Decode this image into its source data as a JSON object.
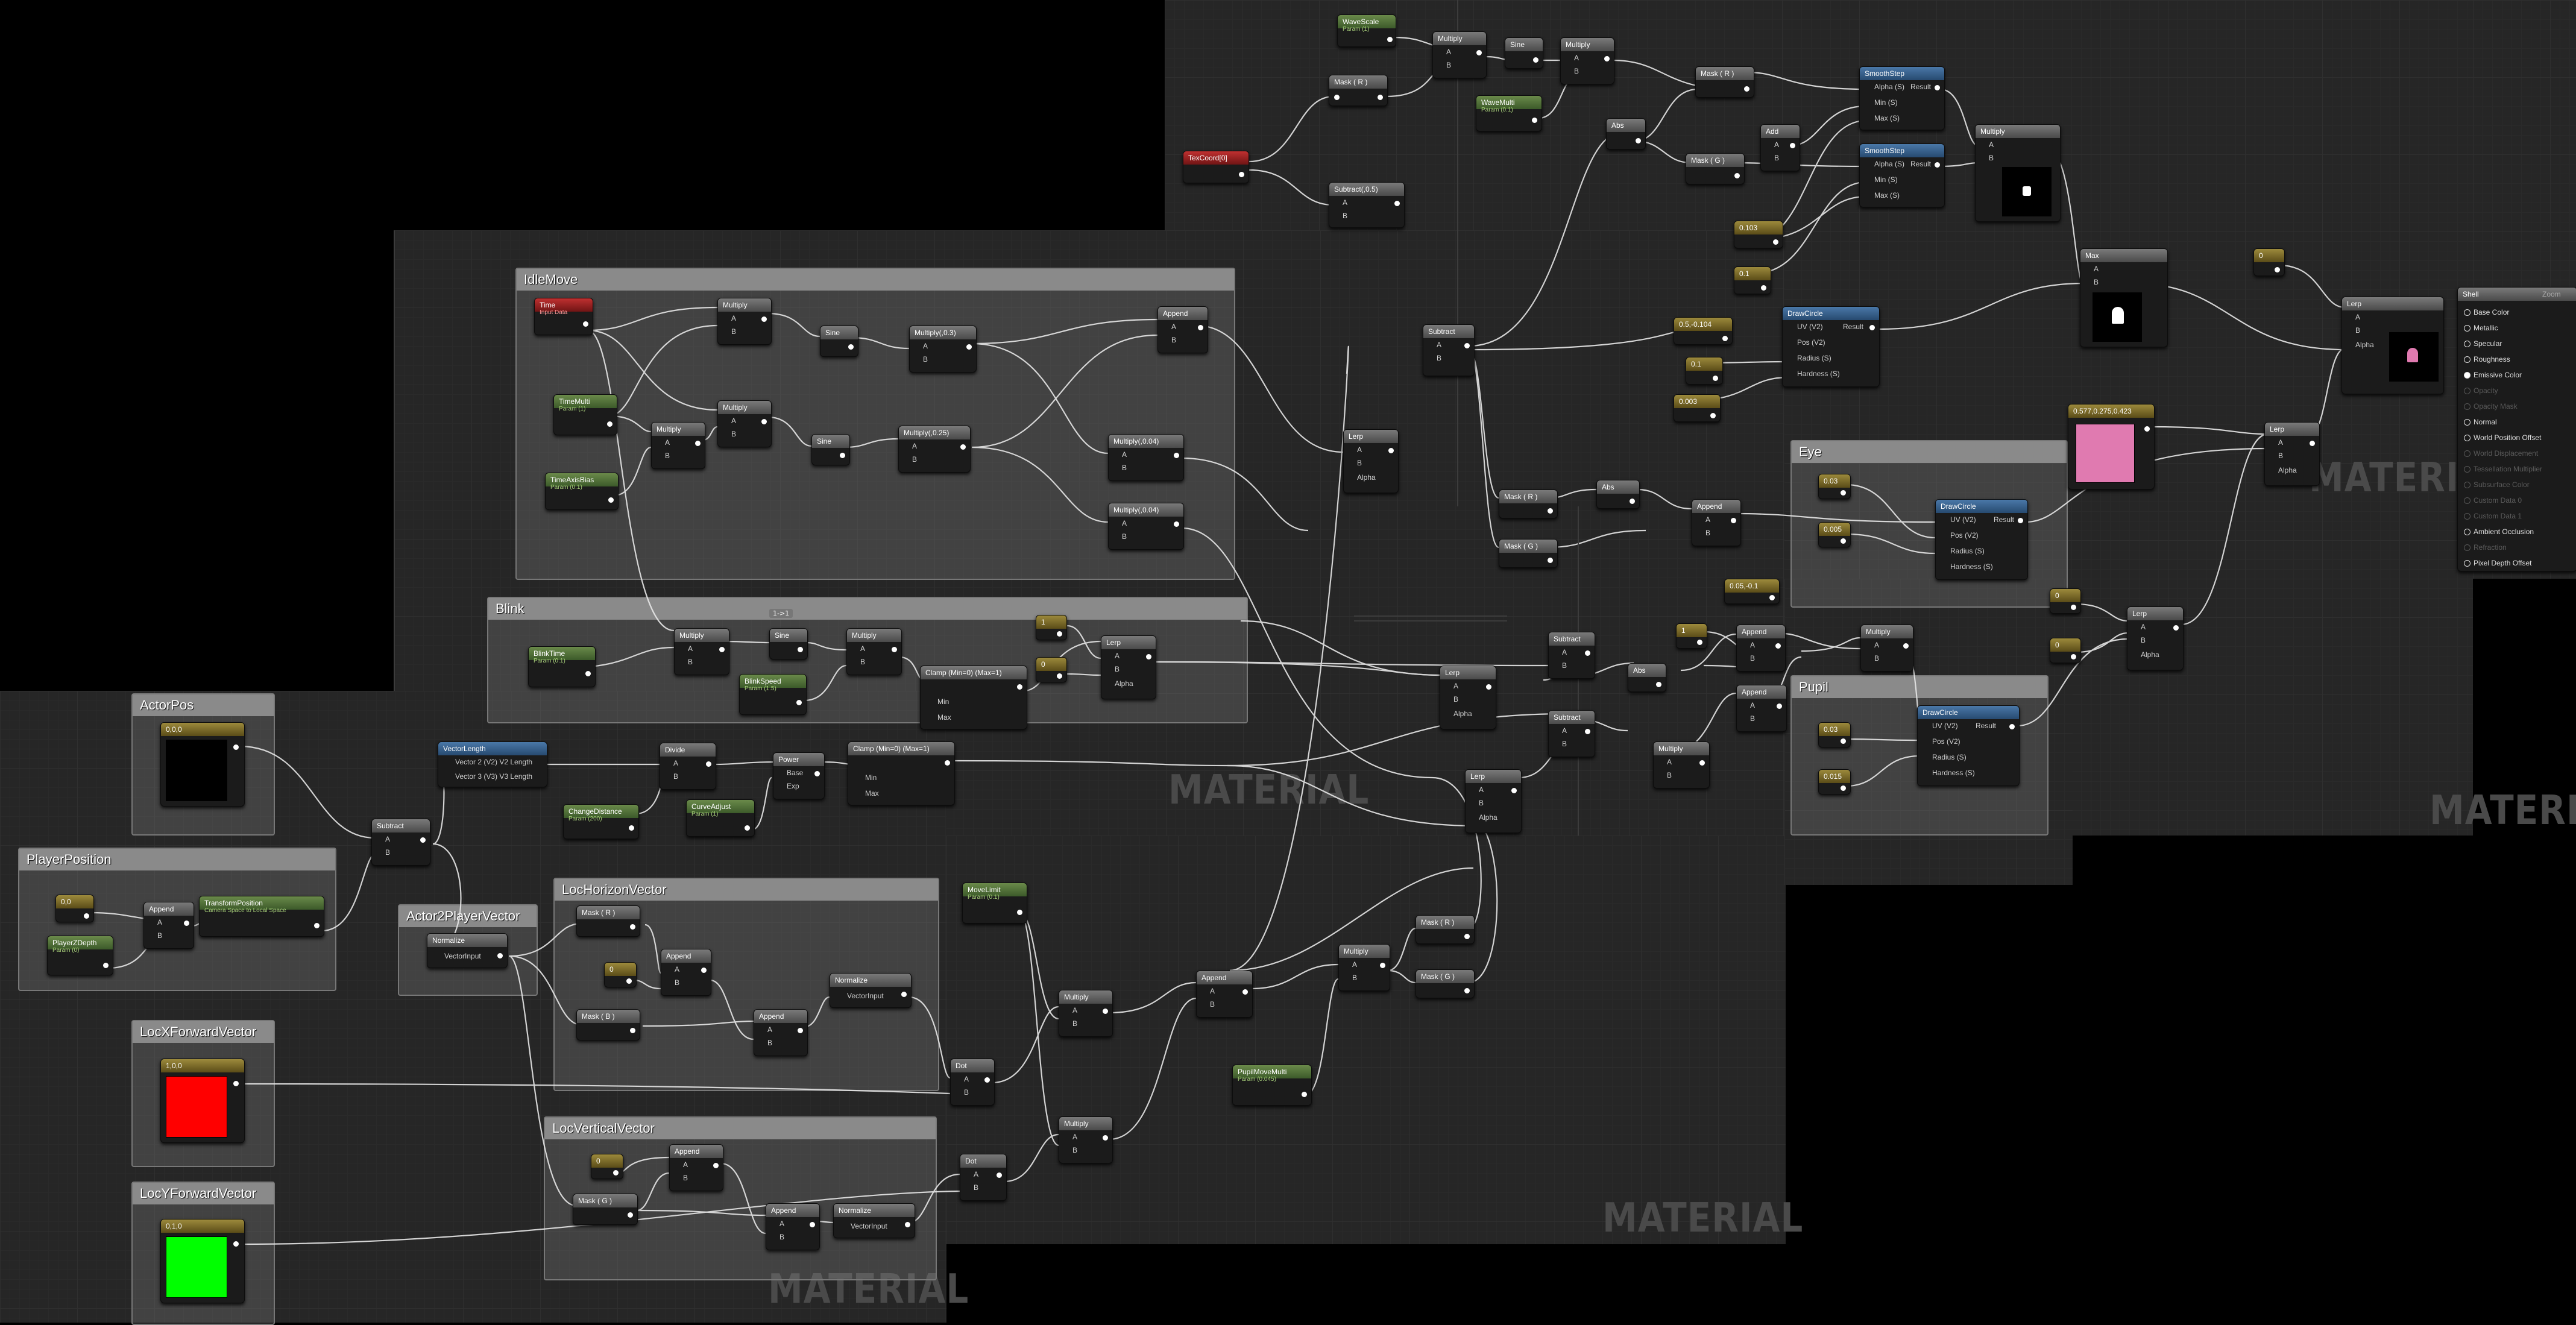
{
  "watermark": "MATERIAL",
  "colors": {
    "panel": "#262626",
    "comment": "#8a8a8a",
    "param": "#5a7a3a",
    "red_swatch": "#ff0000",
    "green_swatch": "#00ff00",
    "pink_swatch": "#e07ab0"
  },
  "comments": {
    "idle_move": "IdleMove",
    "blink": "Blink",
    "actor_pos": "ActorPos",
    "player_position": "PlayerPosition",
    "actor2player": "Actor2PlayerVector",
    "loc_horizon": "LocHorizonVector",
    "loc_vertical": "LocVerticalVector",
    "locx_forward": "LocXForwardVector",
    "locy_forward": "LocYForwardVector",
    "eye": "Eye",
    "pupil": "Pupil"
  },
  "nodes": {
    "wave_scale": {
      "title": "WaveScale",
      "sub": "Param (1)"
    },
    "mask_r_top": {
      "title": "Mask ( R )"
    },
    "multiply_top1": {
      "title": "Multiply"
    },
    "sine_top": {
      "title": "Sine"
    },
    "multiply_top2": {
      "title": "Multiply"
    },
    "wave_multi": {
      "title": "WaveMulti",
      "sub": "Param (0.1)"
    },
    "texcoord": {
      "title": "TexCoord[0]"
    },
    "subtract_03": {
      "title": "Subtract(,0.5)"
    },
    "abs_top": {
      "title": "Abs"
    },
    "mask_r2": {
      "title": "Mask ( R )"
    },
    "mask_g2": {
      "title": "Mask ( G )"
    },
    "add_top": {
      "title": "Add"
    },
    "smoothstep1": {
      "title": "SmoothStep"
    },
    "smoothstep2": {
      "title": "SmoothStep"
    },
    "multiply_mask": {
      "title": "Multiply"
    },
    "const_0103": {
      "title": "0.103"
    },
    "const_01": {
      "title": "0.1"
    },
    "max": {
      "title": "Max"
    },
    "const_0": {
      "title": "0"
    },
    "lerp_final": {
      "title": "Lerp"
    },
    "subtract_mid": {
      "title": "Subtract"
    },
    "vec_05": {
      "title": "0.5,-0.104"
    },
    "const_01b": {
      "title": "0.1"
    },
    "const_0003": {
      "title": "0.003"
    },
    "draw_circle1": {
      "title": "DrawCircle"
    },
    "color_pink": {
      "title": "0.577,0.275,0.423"
    },
    "lerp_eye": {
      "title": "Lerp"
    },
    "time": {
      "title": "Time",
      "sub": "Input Data"
    },
    "time_multi": {
      "title": "TimeMulti",
      "sub": "Param (1)"
    },
    "time_axis_bias": {
      "title": "TimeAxisBias",
      "sub": "Param (0.1)"
    },
    "blink_time": {
      "title": "BlinkTime",
      "sub": "Param (0.1)"
    },
    "blink_speed": {
      "title": "BlinkSpeed",
      "sub": "Param (1.5)"
    },
    "clamp1": {
      "title": "Clamp (Min=0) (Max=1)"
    },
    "clamp2": {
      "title": "Clamp (Min=0) (Max=1)"
    },
    "vector_length": {
      "title": "VectorLength"
    },
    "divide": {
      "title": "Divide"
    },
    "power": {
      "title": "Power"
    },
    "change_distance": {
      "title": "ChangeDistance",
      "sub": "Param (200)"
    },
    "curve_adjust": {
      "title": "CurveAdjust",
      "sub": "Param (1)"
    },
    "actor_pos_c": {
      "title": "0,0,0"
    },
    "player_pos_c": {
      "title": "0,0"
    },
    "player_z_depth": {
      "title": "PlayerZDepth",
      "sub": "Param (0)"
    },
    "append_pp": {
      "title": "Append"
    },
    "transform_position": {
      "title": "TransformPosition",
      "sub": "Camera Space to Local Space"
    },
    "subtract_ap": {
      "title": "Subtract"
    },
    "normalize_a2p": {
      "title": "Normalize"
    },
    "move_limit": {
      "title": "MoveLimit",
      "sub": "Param (0.1)"
    },
    "pupil_move_multi": {
      "title": "PupilMoveMulti",
      "sub": "Param (0.045)"
    },
    "locx_c": {
      "title": "1,0,0"
    },
    "locy_c": {
      "title": "0,1,0"
    },
    "shell": {
      "title": "Shell"
    }
  },
  "pin_labels": {
    "a": "A",
    "b": "B",
    "alpha": "Alpha",
    "result": "Result",
    "min": "Min",
    "max": "Max",
    "exp": "Exp",
    "base": "Base",
    "uv": "UV (V2)",
    "pos": "Pos (V2)",
    "radius": "Radius (S)",
    "hardness": "Hardness (S)",
    "alpha_s": "Alpha (S)",
    "min_s": "Min (S)",
    "max_s": "Max (S)",
    "v2len": "Vector 2 (V2) V2 Length",
    "v3len": "Vector 3 (V3) V3 Length",
    "vector_input": "VectorInput"
  },
  "shell_inputs": [
    "Base Color",
    "Metallic",
    "Specular",
    "Roughness",
    "Emissive Color",
    "Opacity",
    "Opacity Mask",
    "Normal",
    "World Position Offset",
    "World Displacement",
    "Tessellation Multiplier",
    "Subsurface Color",
    "Custom Data 0",
    "Custom Data 1",
    "Ambient Occlusion",
    "Refraction",
    "Pixel Depth Offset"
  ],
  "misc": {
    "zoom": "Zoom",
    "reroute": "1->1"
  }
}
